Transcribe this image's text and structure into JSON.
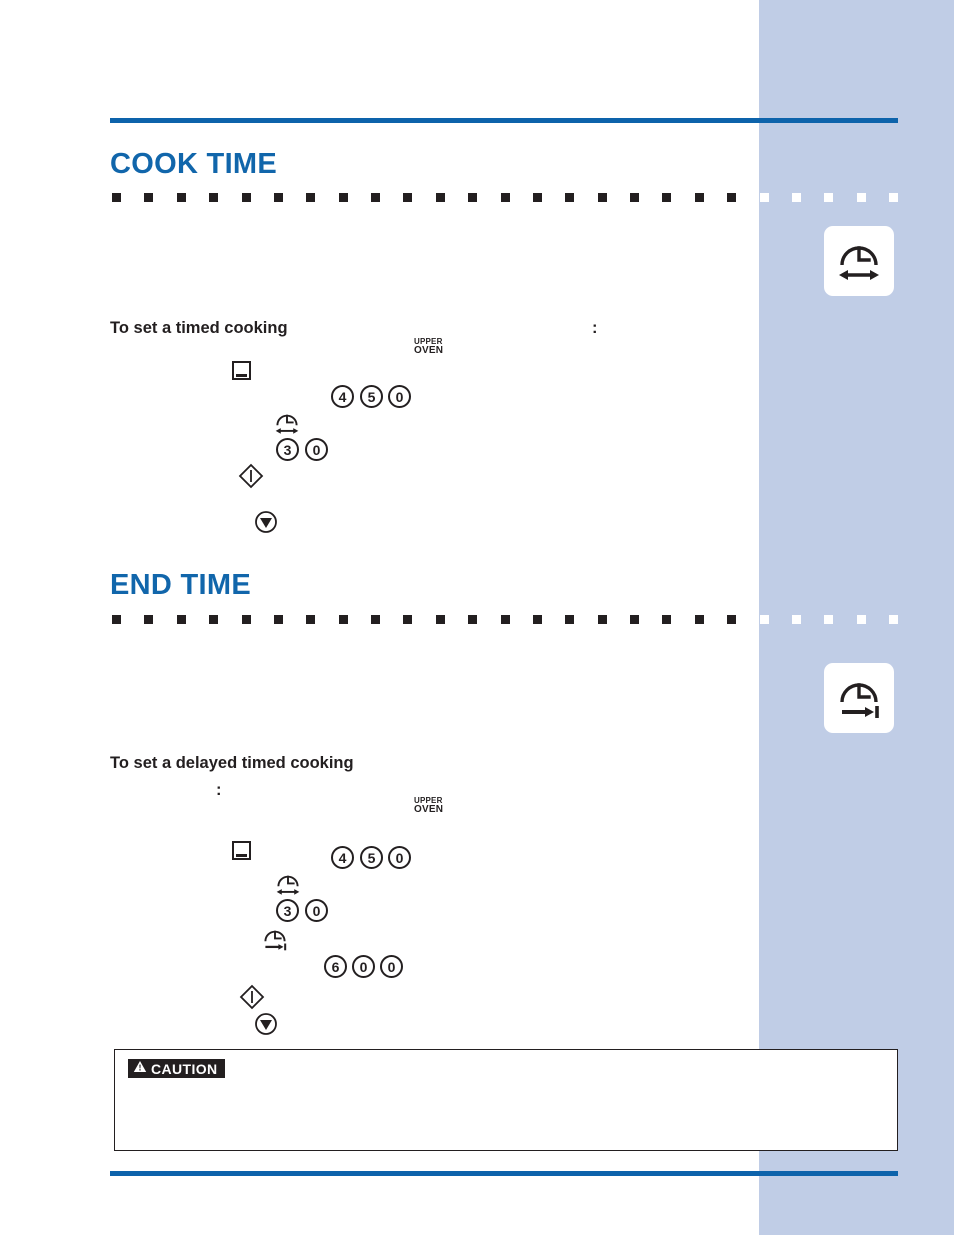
{
  "page": {
    "background_color": "#ffffff",
    "side_panel_color": "#c0cde6",
    "rule_color": "#0d63ab",
    "heading_color": "#1166ab",
    "ink_color": "#231f20"
  },
  "sections": [
    {
      "heading": "COOK TIME",
      "sub_heading": "To set a timed cooking",
      "trailing_punctuation": ":",
      "panel_label": {
        "line1": "UPPER",
        "line2": "OVEN"
      },
      "badge_icon": "clock-double-arrow-icon",
      "steps": [
        {
          "icon": "oven-bake-icon"
        },
        {
          "keys": [
            "4",
            "5",
            "0"
          ]
        },
        {
          "icon": "cook-time-clock-icon"
        },
        {
          "keys": [
            "3",
            "0"
          ]
        },
        {
          "icon": "start-icon"
        },
        {
          "icon": "cancel-icon"
        }
      ]
    },
    {
      "heading": "END TIME",
      "sub_heading": "To set a delayed timed cooking",
      "trailing_punctuation": ":",
      "panel_label": {
        "line1": "UPPER",
        "line2": "OVEN"
      },
      "badge_icon": "clock-arrow-to-bar-icon",
      "steps": [
        {
          "icon": "oven-bake-icon"
        },
        {
          "keys": [
            "4",
            "5",
            "0"
          ]
        },
        {
          "icon": "cook-time-clock-icon"
        },
        {
          "keys": [
            "3",
            "0"
          ]
        },
        {
          "icon": "end-time-clock-icon"
        },
        {
          "keys": [
            "6",
            "0",
            "0"
          ]
        },
        {
          "icon": "start-icon"
        },
        {
          "icon": "cancel-icon"
        }
      ]
    }
  ],
  "caution": {
    "label": "CAUTION",
    "icon": "warning-triangle-icon",
    "body": ""
  },
  "separator": {
    "dark_squares": 25,
    "knockout_squares": 5
  },
  "keypads": {
    "cook_temp": [
      "4",
      "5",
      "0"
    ],
    "cook_duration": [
      "3",
      "0"
    ],
    "end_temp": [
      "4",
      "5",
      "0"
    ],
    "end_duration": [
      "3",
      "0"
    ],
    "end_clock": [
      "6",
      "0",
      "0"
    ]
  }
}
